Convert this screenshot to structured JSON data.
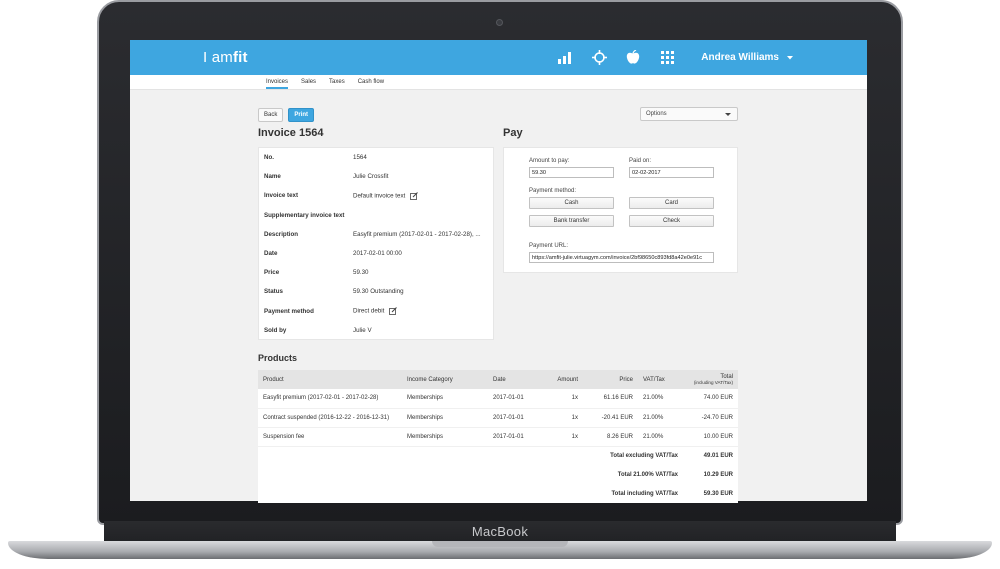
{
  "device": {
    "brand": "MacBook"
  },
  "header": {
    "logo_prefix": "I am",
    "logo_suffix": "fit",
    "icons": [
      "bar-chart-icon",
      "crosshair-icon",
      "apple-icon",
      "grid-icon"
    ],
    "user_name": "Andrea Williams",
    "accent": "#3ea6e0"
  },
  "subnav": {
    "items": [
      "Invoices",
      "Sales",
      "Taxes",
      "Cash flow"
    ],
    "active": "Invoices"
  },
  "toolbar": {
    "back": "Back",
    "print": "Print",
    "options": "Options"
  },
  "invoice": {
    "title": "Invoice 1564",
    "rows": [
      {
        "label": "No.",
        "value": "1564"
      },
      {
        "label": "Name",
        "value": "Julie Crossfit"
      },
      {
        "label": "Invoice text",
        "value": "Default invoice text"
      },
      {
        "label": "Supplementary invoice text",
        "value": ""
      },
      {
        "label": "Description",
        "value": "Easyfit premium (2017-02-01 - 2017-02-28), ..."
      },
      {
        "label": "Date",
        "value": "2017-02-01 00:00"
      },
      {
        "label": "Price",
        "value": "59.30"
      },
      {
        "label": "Status",
        "value": "59.30 Outstanding"
      },
      {
        "label": "Payment method",
        "value": "Direct debit"
      },
      {
        "label": "Sold by",
        "value": "Julie V"
      }
    ]
  },
  "pay": {
    "title": "Pay",
    "amount_label": "Amount to pay:",
    "amount_value": "59.30",
    "paid_on_label": "Paid on:",
    "paid_on_value": "02-02-2017",
    "method_label": "Payment method:",
    "buttons": {
      "cash": "Cash",
      "card": "Card",
      "bank": "Bank transfer",
      "check": "Check"
    },
    "url_label": "Payment URL:",
    "url_value": "https://amfit-julie.virtuagym.com/invoice/2bf98650c893fd8a42e0e91c"
  },
  "products": {
    "title": "Products",
    "headers": {
      "product": "Product",
      "category": "Income Category",
      "date": "Date",
      "amount": "Amount",
      "price": "Price",
      "vat": "VAT/Tax",
      "total": "Total",
      "total_note": "(including VAT/Tax)"
    },
    "rows": [
      {
        "product": "Easyfit premium (2017-02-01 - 2017-02-28)",
        "category": "Memberships",
        "date": "2017-01-01",
        "amount": "1x",
        "price": "61.16 EUR",
        "vat": "21.00%",
        "total": "74.00 EUR"
      },
      {
        "product": "Contract suspended (2016-12-22 - 2016-12-31)",
        "category": "Memberships",
        "date": "2017-01-01",
        "amount": "1x",
        "price": "-20.41 EUR",
        "vat": "21.00%",
        "total": "-24.70 EUR"
      },
      {
        "product": "Suspension fee",
        "category": "Memberships",
        "date": "2017-01-01",
        "amount": "1x",
        "price": "8.26 EUR",
        "vat": "21.00%",
        "total": "10.00 EUR"
      }
    ],
    "totals": [
      {
        "label": "Total excluding VAT/Tax",
        "value": "49.01 EUR"
      },
      {
        "label": "Total 21.00% VAT/Tax",
        "value": "10.29 EUR"
      },
      {
        "label": "Total including VAT/Tax",
        "value": "59.30 EUR"
      }
    ]
  }
}
